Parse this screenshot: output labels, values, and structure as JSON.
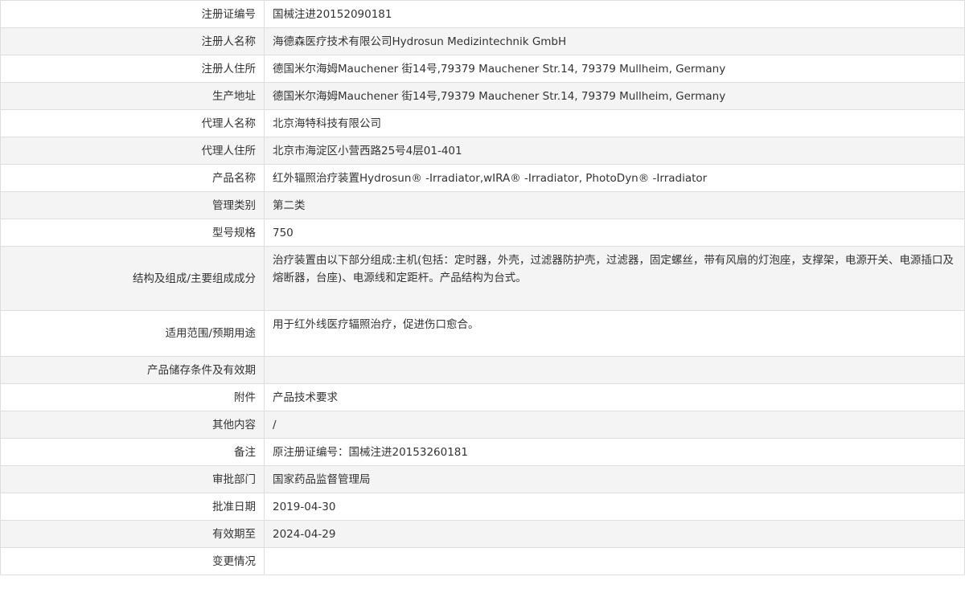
{
  "rows": [
    {
      "label": "注册证编号",
      "value": "国械注进20152090181"
    },
    {
      "label": "注册人名称",
      "value": "海德森医疗技术有限公司Hydrosun Medizintechnik GmbH"
    },
    {
      "label": "注册人住所",
      "value": "德国米尔海姆Mauchener 街14号,79379 Mauchener Str.14, 79379 Mullheim, Germany"
    },
    {
      "label": "生产地址",
      "value": "德国米尔海姆Mauchener 街14号,79379 Mauchener Str.14, 79379 Mullheim, Germany"
    },
    {
      "label": "代理人名称",
      "value": "北京海特科技有限公司"
    },
    {
      "label": "代理人住所",
      "value": "北京市海淀区小营西路25号4层01-401"
    },
    {
      "label": "产品名称",
      "value": "红外辐照治疗装置Hydrosun® -Irradiator,wIRA® -Irradiator, PhotoDyn® -Irradiator"
    },
    {
      "label": "管理类别",
      "value": "第二类"
    },
    {
      "label": "型号规格",
      "value": "750"
    },
    {
      "label": "结构及组成/主要组成成分",
      "value": "治疗装置由以下部分组成:主机(包括：定时器，外壳，过滤器防护壳，过滤器，固定螺丝，带有风扇的灯泡座，支撑架，电源开关、电源插口及熔断器，台座)、电源线和定距杆。产品结构为台式。"
    },
    {
      "label": "适用范围/预期用途",
      "value": "用于红外线医疗辐照治疗，促进伤口愈合。"
    },
    {
      "label": "产品储存条件及有效期",
      "value": ""
    },
    {
      "label": "附件",
      "value": "产品技术要求"
    },
    {
      "label": "其他内容",
      "value": "/"
    },
    {
      "label": "备注",
      "value": "原注册证编号：国械注进20153260181"
    },
    {
      "label": "审批部门",
      "value": "国家药品监督管理局"
    },
    {
      "label": "批准日期",
      "value": "2019-04-30"
    },
    {
      "label": "有效期至",
      "value": "2024-04-29"
    },
    {
      "label": "变更情况",
      "value": ""
    }
  ]
}
